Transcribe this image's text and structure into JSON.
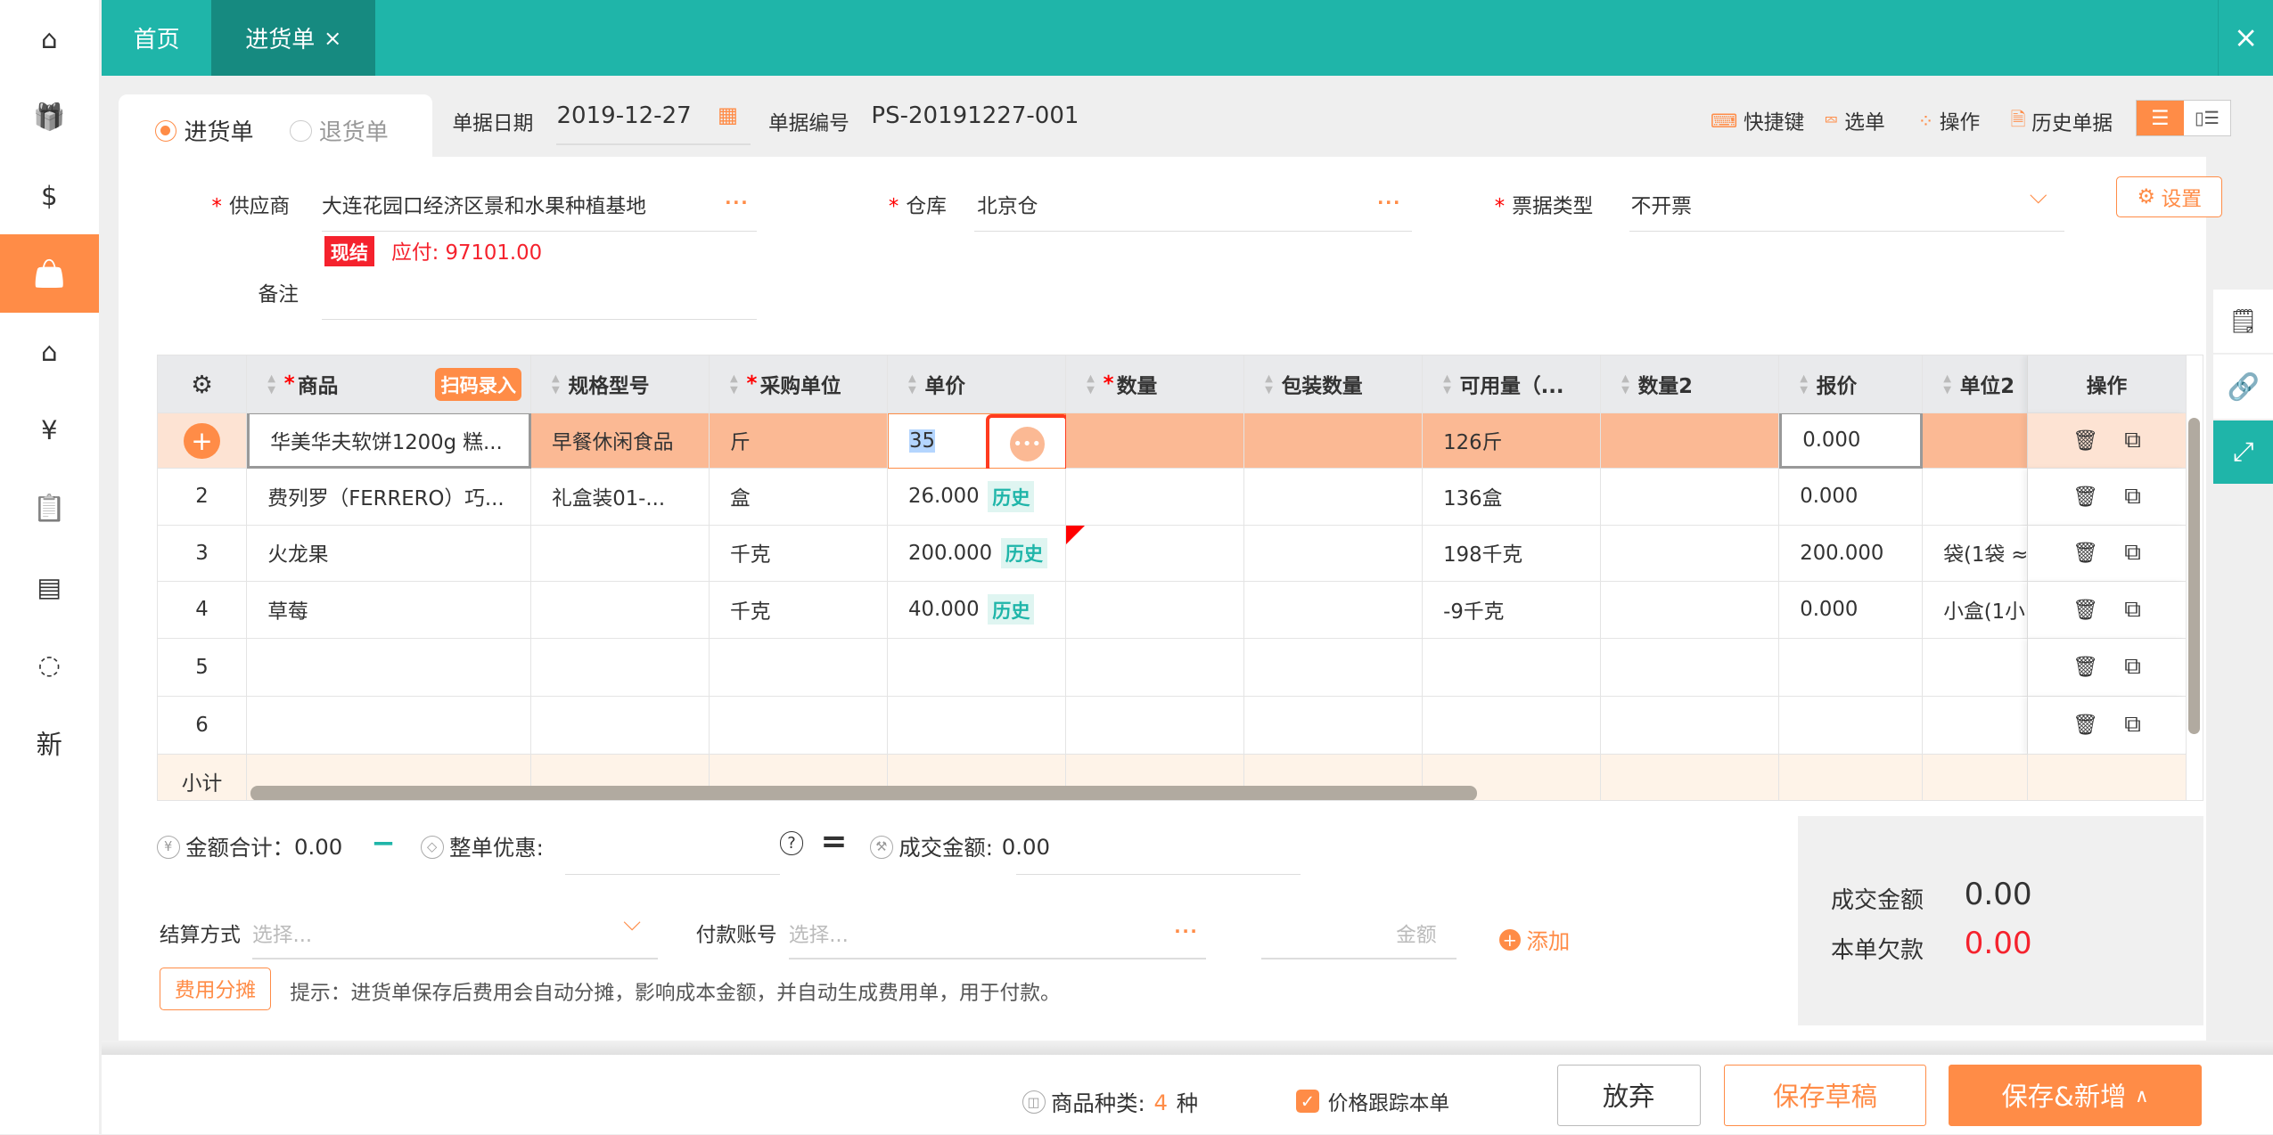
{
  "sidebar": {
    "items": [
      {
        "icon": "home-icon",
        "glyph": "⌂"
      },
      {
        "icon": "gift-icon",
        "glyph": "🎁"
      },
      {
        "icon": "money-house-icon",
        "glyph": "$"
      },
      {
        "icon": "shopping-bag-icon",
        "glyph": "👜",
        "active": true
      },
      {
        "icon": "warehouse-icon",
        "glyph": "⌂"
      },
      {
        "icon": "money-bag-icon",
        "glyph": "¥"
      },
      {
        "icon": "clipboard-icon",
        "glyph": "📋"
      },
      {
        "icon": "contact-card-icon",
        "glyph": "▤"
      },
      {
        "icon": "network-icon",
        "glyph": "◌"
      },
      {
        "icon": "new-icon",
        "glyph": "新"
      }
    ]
  },
  "tabs": [
    {
      "label": "首页"
    },
    {
      "label": "进货单",
      "closable": true
    }
  ],
  "window_close": "×",
  "doc_type": {
    "options": [
      "进货单",
      "退货单"
    ],
    "selected": "进货单"
  },
  "header": {
    "date_label": "单据日期",
    "date_value": "2019-12-27",
    "number_label": "单据编号",
    "number_value": "PS-20191227-001"
  },
  "toolbar": {
    "shortcuts": "快捷键",
    "select_order": "选单",
    "operations": "操作",
    "history": "历史单据"
  },
  "form": {
    "supplier_label": "供应商",
    "supplier_value": "大连花园口经济区景和水果种植基地",
    "settle_badge": "现结",
    "payable": "应付: 97101.00",
    "warehouse_label": "仓库",
    "warehouse_value": "北京仓",
    "invoice_label": "票据类型",
    "invoice_value": "不开票",
    "remark_label": "备注",
    "remark_value": "",
    "settings": "设置",
    "more": "···"
  },
  "table": {
    "scan_button": "扫码录入",
    "columns": [
      {
        "key": "idx",
        "label": ""
      },
      {
        "key": "product",
        "label": "商品",
        "required": true,
        "sortable": true
      },
      {
        "key": "spec",
        "label": "规格型号",
        "sortable": true
      },
      {
        "key": "unit",
        "label": "采购单位",
        "required": true,
        "sortable": true
      },
      {
        "key": "price",
        "label": "单价",
        "sortable": true
      },
      {
        "key": "qty",
        "label": "数量",
        "required": true,
        "sortable": true
      },
      {
        "key": "pack",
        "label": "包装数量",
        "sortable": true
      },
      {
        "key": "avail",
        "label": "可用量（...",
        "sortable": true
      },
      {
        "key": "qty2",
        "label": "数量2",
        "sortable": true
      },
      {
        "key": "quote",
        "label": "报价",
        "sortable": true
      },
      {
        "key": "unit2",
        "label": "单位2",
        "sortable": true
      },
      {
        "key": "ops",
        "label": "操作"
      }
    ],
    "rows": [
      {
        "idx": "+",
        "product": "华美华夫软饼1200g 糕...",
        "spec": "早餐休闲食品",
        "unit": "斤",
        "price": "35",
        "qty": "",
        "pack": "",
        "avail": "126斤",
        "qty2": "",
        "quote": "0.000",
        "unit2": "",
        "selected": true
      },
      {
        "idx": "2",
        "product": "费列罗（FERRERO）巧...",
        "spec": "礼盒装01-...",
        "unit": "盒",
        "price": "26.000",
        "history": "历史",
        "qty": "",
        "pack": "",
        "avail": "136盒",
        "qty2": "",
        "quote": "0.000",
        "unit2": ""
      },
      {
        "idx": "3",
        "product": "火龙果",
        "spec": "",
        "unit": "千克",
        "price": "200.000",
        "history": "历史",
        "qty": "",
        "pack": "",
        "avail": "198千克",
        "qty2": "",
        "quote": "200.000",
        "unit2": "袋(1袋 ≈"
      },
      {
        "idx": "4",
        "product": "草莓",
        "spec": "",
        "unit": "千克",
        "price": "40.000",
        "history": "历史",
        "qty": "",
        "pack": "",
        "avail": "-9千克",
        "qty2": "",
        "quote": "0.000",
        "unit2": "小盒(1小"
      },
      {
        "idx": "5"
      },
      {
        "idx": "6"
      }
    ],
    "subtotal_label": "小计"
  },
  "totals": {
    "amount_label": "金额合计：",
    "amount_value": "0.00",
    "minus": "−",
    "discount_label": "整单优惠:",
    "equals": "=",
    "deal_label": "成交金额:",
    "deal_value": "0.00",
    "help": "?"
  },
  "payment": {
    "method_label": "结算方式",
    "method_placeholder": "选择...",
    "account_label": "付款账号",
    "account_placeholder": "选择...",
    "amount_placeholder": "金额",
    "add": "添加"
  },
  "fee": {
    "button": "费用分摊",
    "hint": "提示：进货单保存后费用会自动分摊，影响成本金额，并自动生成费用单，用于付款。"
  },
  "summary": {
    "deal_label": "成交金额",
    "deal_value": "0.00",
    "owed_label": "本单欠款",
    "owed_value": "0.00"
  },
  "footer": {
    "kinds_label": "商品种类:",
    "kinds_value": "4",
    "kinds_unit": "种",
    "track_label": "价格跟踪本单",
    "track_checked": true,
    "discard": "放弃",
    "save_draft": "保存草稿",
    "save_new": "保存&新增",
    "save_new_arrow": "∧"
  },
  "colors": {
    "accent": "#ff8c47",
    "teal": "#1fb5a9",
    "danger": "#f5222d"
  }
}
